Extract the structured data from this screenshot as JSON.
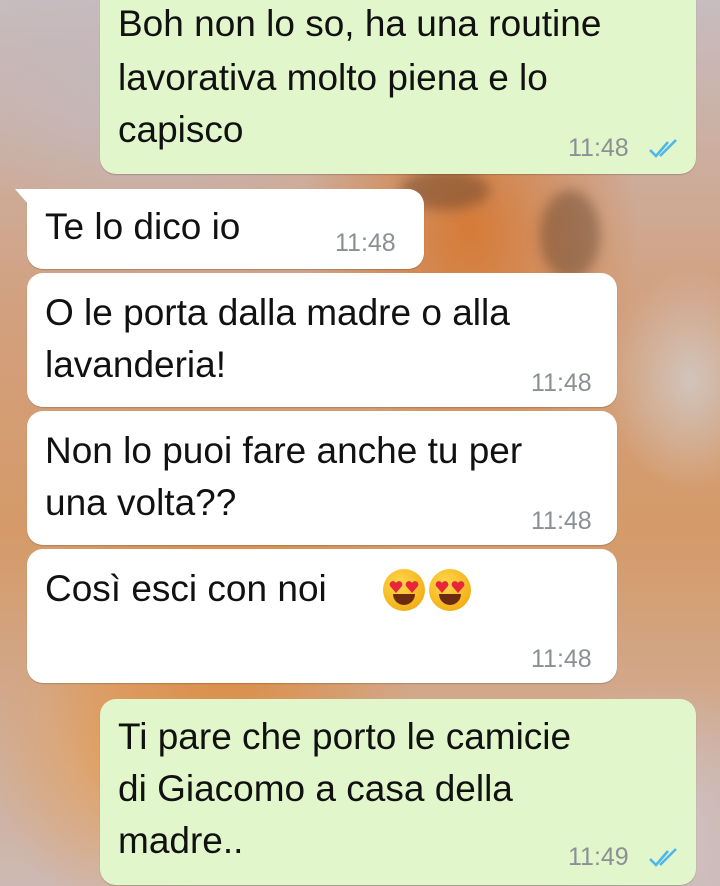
{
  "messages": [
    {
      "direction": "out",
      "lines": [
        "Boh non lo so, ha una routine",
        "lavorativa molto piena e lo",
        "capisco"
      ],
      "time": "11:48",
      "status": "read"
    },
    {
      "direction": "in",
      "lines": [
        "Te lo dico io"
      ],
      "time": "11:48"
    },
    {
      "direction": "in",
      "lines": [
        "O le porta dalla madre o alla",
        "lavanderia!"
      ],
      "time": "11:48"
    },
    {
      "direction": "in",
      "lines": [
        "Non lo puoi fare anche tu per",
        "una volta??"
      ],
      "time": "11:48"
    },
    {
      "direction": "in",
      "lines": [
        "Così esci con noi"
      ],
      "emoji": [
        "smiling-face-with-heart-eyes",
        "smiling-face-with-heart-eyes"
      ],
      "time": "11:48"
    },
    {
      "direction": "out",
      "lines": [
        "Ti pare che porto le camicie",
        "di Giacomo a casa della",
        "madre.."
      ],
      "time": "11:49",
      "status": "read"
    }
  ],
  "colors": {
    "incoming_bubble": "#ffffff",
    "outgoing_bubble": "#e1f7cb",
    "timestamp": "#8b9095",
    "read_ticks": "#4fb6ec"
  },
  "icons": {
    "read_status": "double-check-icon",
    "emoji": "heart-eyes-emoji"
  }
}
